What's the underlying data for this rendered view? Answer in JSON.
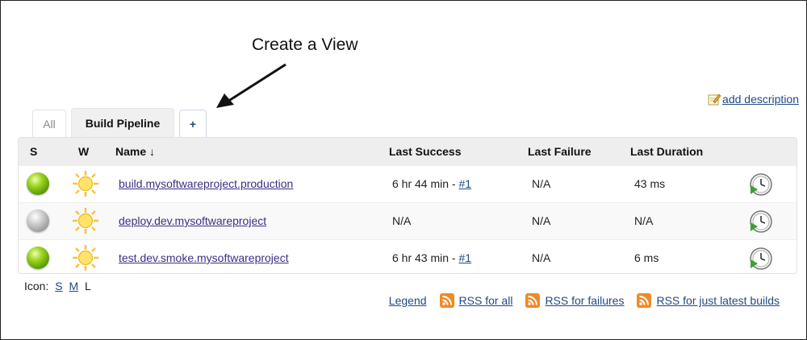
{
  "annotation": {
    "text": "Create a View"
  },
  "add_description": {
    "label": "add description"
  },
  "tabs": [
    {
      "label": "All"
    },
    {
      "label": "Build Pipeline"
    },
    {
      "label": "+"
    }
  ],
  "table": {
    "headers": {
      "s": "S",
      "w": "W",
      "name": "Name ↓",
      "last_success": "Last Success",
      "last_failure": "Last Failure",
      "last_duration": "Last Duration"
    },
    "rows": [
      {
        "status": "success",
        "weather": "sunny",
        "name": "build.mysoftwareproject.production",
        "last_success": "6 hr 44 min - ",
        "last_success_build": "#1",
        "last_failure": "N/A",
        "last_duration": "43 ms",
        "action_icon": "schedule-build-icon"
      },
      {
        "status": "not-built",
        "weather": "sunny",
        "name": "deploy.dev.mysoftwareproject",
        "last_success": "N/A",
        "last_success_build": "",
        "last_failure": "N/A",
        "last_duration": "N/A",
        "action_icon": "schedule-build-icon"
      },
      {
        "status": "success",
        "weather": "sunny",
        "name": "test.dev.smoke.mysoftwareproject",
        "last_success": "6 hr 43 min - ",
        "last_success_build": "#1",
        "last_failure": "N/A",
        "last_duration": "6 ms",
        "action_icon": "schedule-build-icon"
      }
    ]
  },
  "icon_size": {
    "label": "Icon:",
    "options": [
      "S",
      "M",
      "L"
    ],
    "selected": "L"
  },
  "footer": {
    "legend": "Legend",
    "rss_all": "RSS for all",
    "rss_failures": "RSS for failures",
    "rss_latest": "RSS for just latest builds"
  },
  "colors": {
    "link": "#204a87",
    "visited_link": "#3b2f88",
    "header_bg": "#eeeeee",
    "rss": "#f08a24"
  }
}
